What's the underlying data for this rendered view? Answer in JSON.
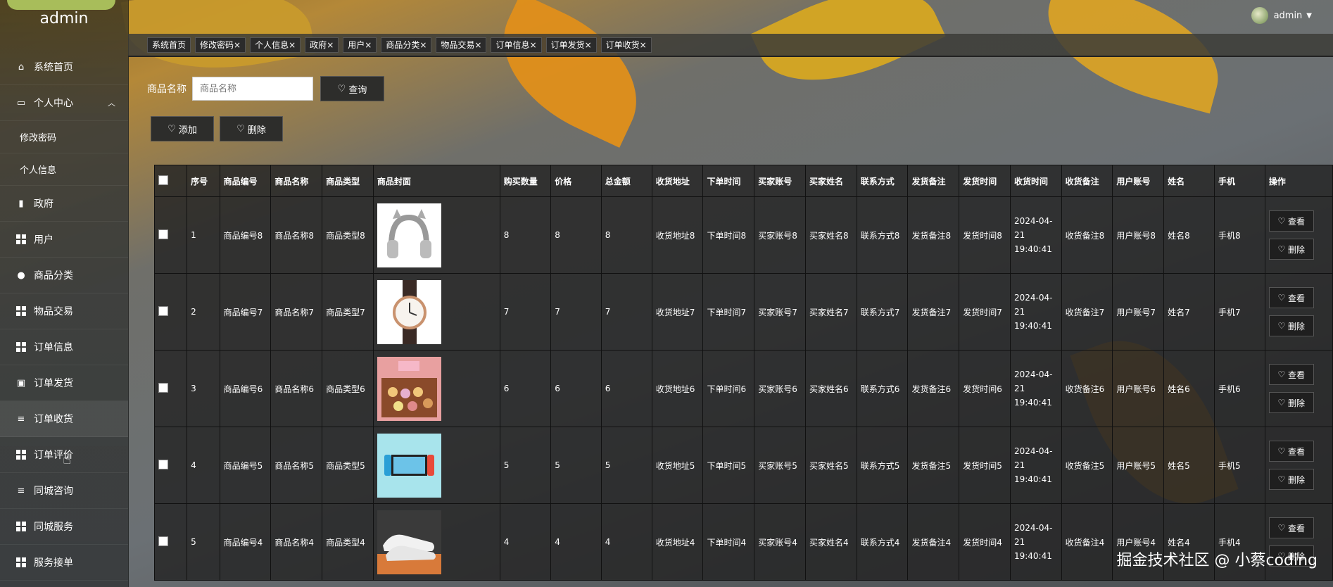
{
  "sidebar": {
    "brand": "admin",
    "items": [
      {
        "label": "系统首页",
        "icon": "home-icon"
      },
      {
        "label": "个人中心",
        "icon": "id-card-icon"
      },
      {
        "label": "修改密码",
        "icon": ""
      },
      {
        "label": "个人信息",
        "icon": ""
      },
      {
        "label": "政府",
        "icon": "bar-icon"
      },
      {
        "label": "用户",
        "icon": "grid-icon"
      },
      {
        "label": "商品分类",
        "icon": "bulb-icon"
      },
      {
        "label": "物品交易",
        "icon": "grid-icon"
      },
      {
        "label": "订单信息",
        "icon": "grid-icon"
      },
      {
        "label": "订单发货",
        "icon": "clipboard-icon"
      },
      {
        "label": "订单收货",
        "icon": "list-icon"
      },
      {
        "label": "订单评价",
        "icon": "grid-icon"
      },
      {
        "label": "同城咨询",
        "icon": "list-icon"
      },
      {
        "label": "同城服务",
        "icon": "grid-icon"
      },
      {
        "label": "服务接单",
        "icon": "grid-icon"
      }
    ]
  },
  "header": {
    "user": "admin"
  },
  "tabs": [
    "系统首页",
    "修改密码",
    "个人信息",
    "政府",
    "用户",
    "商品分类",
    "物品交易",
    "订单信息",
    "订单发货",
    "订单收货"
  ],
  "search": {
    "label": "商品名称",
    "placeholder": "商品名称",
    "button": "查询"
  },
  "actions": {
    "add": "添加",
    "delete": "删除"
  },
  "table": {
    "columns": [
      "序号",
      "商品编号",
      "商品名称",
      "商品类型",
      "商品封面",
      "购买数量",
      "价格",
      "总金额",
      "收货地址",
      "下单时间",
      "买家账号",
      "买家姓名",
      "联系方式",
      "发货备注",
      "发货时间",
      "收货时间",
      "收货备注",
      "用户账号",
      "姓名",
      "手机",
      "操作"
    ],
    "rows": [
      [
        "1",
        "商品编号8",
        "商品名称8",
        "商品类型8",
        "",
        "8",
        "8",
        "8",
        "收货地址8",
        "下单时间8",
        "买家账号8",
        "买家姓名8",
        "联系方式8",
        "发货备注8",
        "发货时间8",
        "2024-04-21 19:40:41",
        "收货备注8",
        "用户账号8",
        "姓名8",
        "手机8"
      ],
      [
        "2",
        "商品编号7",
        "商品名称7",
        "商品类型7",
        "",
        "7",
        "7",
        "7",
        "收货地址7",
        "下单时间7",
        "买家账号7",
        "买家姓名7",
        "联系方式7",
        "发货备注7",
        "发货时间7",
        "2024-04-21 19:40:41",
        "收货备注7",
        "用户账号7",
        "姓名7",
        "手机7"
      ],
      [
        "3",
        "商品编号6",
        "商品名称6",
        "商品类型6",
        "",
        "6",
        "6",
        "6",
        "收货地址6",
        "下单时间6",
        "买家账号6",
        "买家姓名6",
        "联系方式6",
        "发货备注6",
        "发货时间6",
        "2024-04-21 19:40:41",
        "收货备注6",
        "用户账号6",
        "姓名6",
        "手机6"
      ],
      [
        "4",
        "商品编号5",
        "商品名称5",
        "商品类型5",
        "",
        "5",
        "5",
        "5",
        "收货地址5",
        "下单时间5",
        "买家账号5",
        "买家姓名5",
        "联系方式5",
        "发货备注5",
        "发货时间5",
        "2024-04-21 19:40:41",
        "收货备注5",
        "用户账号5",
        "姓名5",
        "手机5"
      ],
      [
        "5",
        "商品编号4",
        "商品名称4",
        "商品类型4",
        "",
        "4",
        "4",
        "4",
        "收货地址4",
        "下单时间4",
        "买家账号4",
        "买家姓名4",
        "联系方式4",
        "发货备注4",
        "发货时间4",
        "2024-04-21 19:40:41",
        "收货备注4",
        "用户账号4",
        "姓名4",
        "手机4"
      ]
    ],
    "row_actions": {
      "view": "查看",
      "delete": "删除"
    }
  },
  "watermark": "掘金技术社区 @ 小蔡coding"
}
